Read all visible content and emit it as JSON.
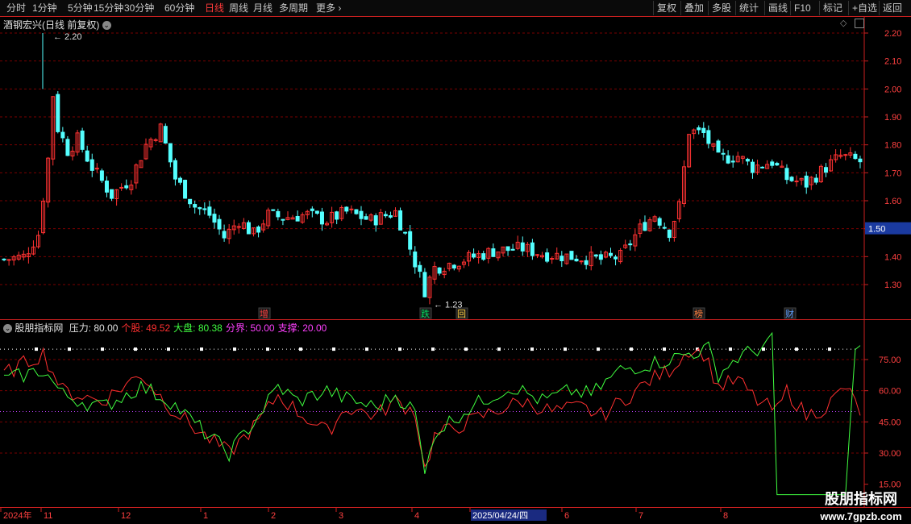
{
  "toolbar": {
    "left_items": [
      "分时",
      "1分钟",
      "5分钟",
      "15分钟",
      "30分钟",
      "60分钟",
      "日线",
      "周线",
      "月线",
      "多周期",
      "更多"
    ],
    "active": "日线",
    "right_items": [
      "复权",
      "叠加",
      "多股",
      "统计",
      "画线",
      "F10",
      "标记",
      "+自选",
      "返回"
    ]
  },
  "main_chart": {
    "title": "酒钢宏兴(日线 前复权)",
    "high_label": "2.20",
    "low_label": "1.23",
    "y_ticks": [
      "2.20",
      "2.10",
      "2.00",
      "1.90",
      "1.80",
      "1.70",
      "1.60",
      "1.50",
      "1.40",
      "1.30"
    ],
    "current_price": "1.50",
    "markers": [
      {
        "text": "增",
        "color": "#ff4040"
      },
      {
        "text": "跌",
        "color": "#00e060"
      },
      {
        "text": "回",
        "color": "#ffd040"
      },
      {
        "text": "榜",
        "color": "#ff8040"
      },
      {
        "text": "财",
        "color": "#60a0ff"
      }
    ]
  },
  "indicator": {
    "name": "股朋指标网",
    "values": [
      {
        "label": "压力:",
        "value": "80.00",
        "color": "#e0e0e0"
      },
      {
        "label": "个股:",
        "value": "49.52",
        "color": "#ff3030"
      },
      {
        "label": "大盘:",
        "value": "80.38",
        "color": "#40ff40"
      },
      {
        "label": "分界:",
        "value": "50.00",
        "color": "#ff40ff"
      },
      {
        "label": "支撑:",
        "value": "20.00",
        "color": "#ff40ff"
      }
    ],
    "y_ticks": [
      "75.00",
      "60.00",
      "45.00",
      "30.00",
      "15.00"
    ]
  },
  "date_axis": {
    "labels": [
      "2024年",
      "11",
      "12",
      "1",
      "2",
      "3",
      "4",
      "2025/04/24/四",
      "6",
      "7",
      "8"
    ],
    "highlight": "2025/04/24/四"
  },
  "watermark": {
    "title": "股朋指标网",
    "url": "www.7gpzb.com"
  },
  "colors": {
    "up": "#ff3232",
    "down": "#54ffff",
    "grid": "#7a0000",
    "axis": "#cc2020",
    "pressure": "#ffffff",
    "stock": "#ff3030",
    "market": "#40ff40"
  },
  "chart_data": {
    "type": "candlestick",
    "ylim": [
      1.23,
      2.2
    ],
    "high": 2.2,
    "low": 1.23,
    "indicator_levels": {
      "pressure": 80,
      "divider": 50,
      "support": 20
    },
    "indicator_current": {
      "stock": 49.52,
      "market": 80.38
    }
  }
}
